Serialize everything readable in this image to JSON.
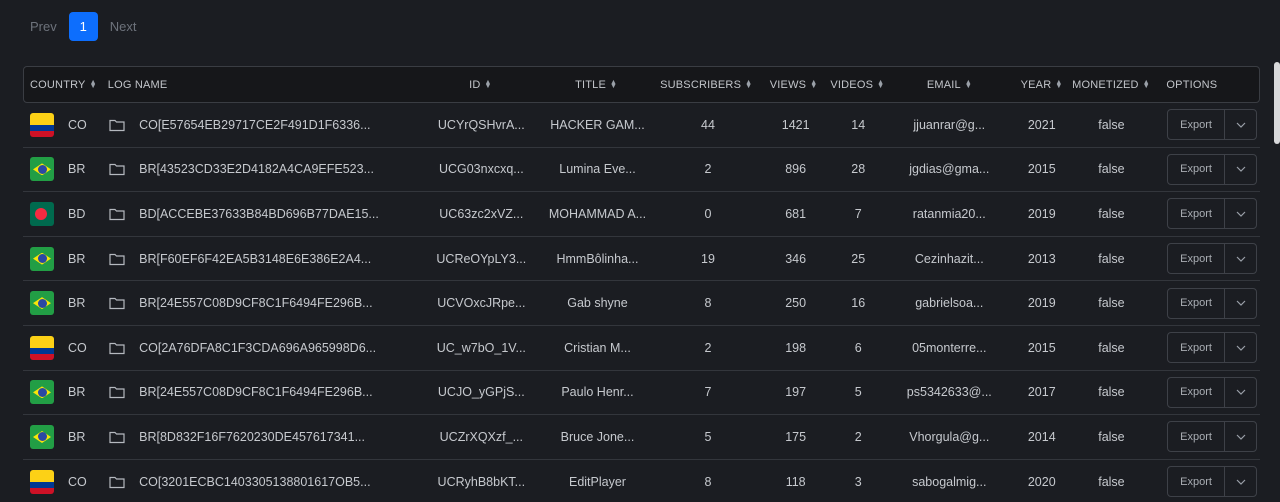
{
  "pagination": {
    "prev": "Prev",
    "current": "1",
    "next": "Next"
  },
  "headers": {
    "country": "COUNTRY",
    "log_name": "LOG NAME",
    "id": "ID",
    "title": "TITLE",
    "subscribers": "SUBSCRIBERS",
    "views": "VIEWS",
    "videos": "VIDEOS",
    "email": "EMAIL",
    "year": "YEAR",
    "monetized": "MONETIZED",
    "options": "OPTIONS"
  },
  "export_label": "Export",
  "rows": [
    {
      "flag": "CO",
      "country": "CO",
      "log": "CO[E57654EB29717CE2F491D1F6336...",
      "id": "UCYrQSHvrA...",
      "title": "HACKER GAM...",
      "subscribers": "44",
      "views": "1421",
      "videos": "14",
      "email": "jjuanrar@g...",
      "year": "2021",
      "monetized": "false"
    },
    {
      "flag": "BR",
      "country": "BR",
      "log": "BR[43523CD33E2D4182A4CA9EFE523...",
      "id": "UCG03nxcxq...",
      "title": "Lumina Eve...",
      "subscribers": "2",
      "views": "896",
      "videos": "28",
      "email": "jgdias@gma...",
      "year": "2015",
      "monetized": "false"
    },
    {
      "flag": "BD",
      "country": "BD",
      "log": "BD[ACCEBE37633B84BD696B77DAE15...",
      "id": "UC63zc2xVZ...",
      "title": "MOHAMMAD A...",
      "subscribers": "0",
      "views": "681",
      "videos": "7",
      "email": "ratanmia20...",
      "year": "2019",
      "monetized": "false"
    },
    {
      "flag": "BR",
      "country": "BR",
      "log": "BR[F60EF6F42EA5B3148E6E386E2A4...",
      "id": "UCReOYpLY3...",
      "title": "HmmBôlinha...",
      "subscribers": "19",
      "views": "346",
      "videos": "25",
      "email": "Cezinhazit...",
      "year": "2013",
      "monetized": "false"
    },
    {
      "flag": "BR",
      "country": "BR",
      "log": "BR[24E557C08D9CF8C1F6494FE296B...",
      "id": "UCVOxcJRpe...",
      "title": "Gab shyne",
      "subscribers": "8",
      "views": "250",
      "videos": "16",
      "email": "gabrielsoa...",
      "year": "2019",
      "monetized": "false"
    },
    {
      "flag": "CO",
      "country": "CO",
      "log": "CO[2A76DFA8C1F3CDA696A965998D6...",
      "id": "UC_w7bO_1V...",
      "title": "Cristian M...",
      "subscribers": "2",
      "views": "198",
      "videos": "6",
      "email": "05monterre...",
      "year": "2015",
      "monetized": "false"
    },
    {
      "flag": "BR",
      "country": "BR",
      "log": "BR[24E557C08D9CF8C1F6494FE296B...",
      "id": "UCJO_yGPjS...",
      "title": "Paulo Henr...",
      "subscribers": "7",
      "views": "197",
      "videos": "5",
      "email": "ps5342633@...",
      "year": "2017",
      "monetized": "false"
    },
    {
      "flag": "BR",
      "country": "BR",
      "log": "BR[8D832F16F7620230DE457617341...",
      "id": "UCZrXQXzf_...",
      "title": "Bruce Jone...",
      "subscribers": "5",
      "views": "175",
      "videos": "2",
      "email": "Vhorgula@g...",
      "year": "2014",
      "monetized": "false"
    },
    {
      "flag": "CO",
      "country": "CO",
      "log": "CO[3201ECBC1403305138801617OB5...",
      "id": "UCRyhB8bKT...",
      "title": "EditPlayer",
      "subscribers": "8",
      "views": "118",
      "videos": "3",
      "email": "sabogalmig...",
      "year": "2020",
      "monetized": "false"
    }
  ]
}
